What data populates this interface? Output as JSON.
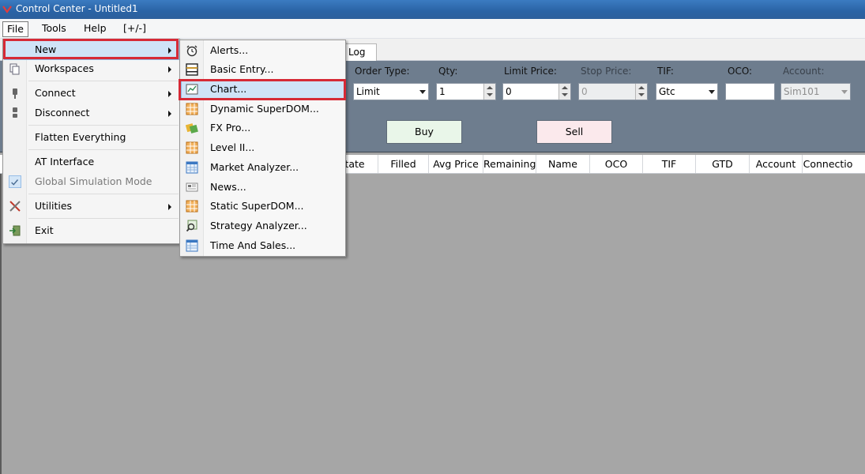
{
  "window": {
    "title": "Control Center - Untitled1"
  },
  "menubar": {
    "file": "File",
    "tools": "Tools",
    "help": "Help",
    "plusminus": "[+/-]"
  },
  "tabs": {
    "log": "Log"
  },
  "order_entry": {
    "order_type_label": "Order Type:",
    "order_type_value": "Limit",
    "qty_label": "Qty:",
    "qty_value": "1",
    "limit_price_label": "Limit Price:",
    "limit_price_value": "0",
    "stop_price_label": "Stop Price:",
    "stop_price_value": "0",
    "tif_label": "TIF:",
    "tif_value": "Gtc",
    "oco_label": "OCO:",
    "oco_value": "",
    "account_label": "Account:",
    "account_value": "Sim101",
    "buy_label": "Buy",
    "sell_label": "Sell"
  },
  "grid": {
    "columns": [
      "tate",
      "Filled",
      "Avg Price",
      "Remaining",
      "Name",
      "OCO",
      "TIF",
      "GTD",
      "Account",
      "Connectio"
    ]
  },
  "file_menu": {
    "items": [
      {
        "label": "New",
        "submenu": true
      },
      {
        "label": "Workspaces",
        "submenu": true
      },
      {
        "label": "Connect",
        "submenu": true
      },
      {
        "label": "Disconnect",
        "submenu": true
      },
      {
        "label": "Flatten Everything"
      },
      {
        "label": "AT Interface"
      },
      {
        "label": "Global Simulation Mode",
        "disabled": true,
        "checked": true
      },
      {
        "label": "Utilities",
        "submenu": true
      },
      {
        "label": "Exit"
      }
    ]
  },
  "new_menu": {
    "items": [
      {
        "label": "Alerts...",
        "icon": "alarm-clock-icon"
      },
      {
        "label": "Basic Entry...",
        "icon": "window-icon"
      },
      {
        "label": "Chart...",
        "icon": "chart-icon"
      },
      {
        "label": "Dynamic SuperDOM...",
        "icon": "grid-icon"
      },
      {
        "label": "FX Pro...",
        "icon": "fx-icon"
      },
      {
        "label": "Level II...",
        "icon": "grid-icon"
      },
      {
        "label": "Market Analyzer...",
        "icon": "table-icon"
      },
      {
        "label": "News...",
        "icon": "news-icon"
      },
      {
        "label": "Static SuperDOM...",
        "icon": "grid-icon"
      },
      {
        "label": "Strategy Analyzer...",
        "icon": "magnifier-icon"
      },
      {
        "label": "Time And Sales...",
        "icon": "table-icon"
      }
    ]
  },
  "colors": {
    "highlight_outline": "#d62a36",
    "menu_hover": "#cfe3f7",
    "title_bar": "#2a63a5"
  }
}
